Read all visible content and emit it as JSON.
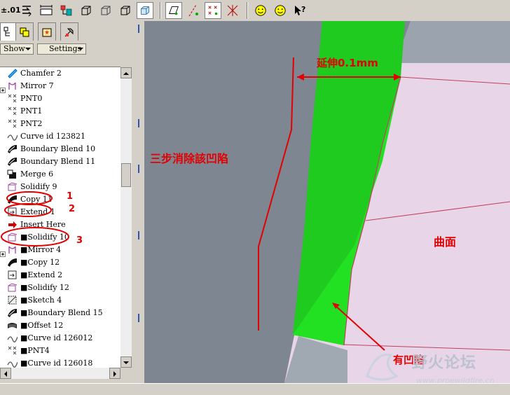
{
  "toolbar": {
    "precision_label": "±.01",
    "tools": [
      "regen-icon",
      "dimension-icon",
      "model-tree-icon",
      "view-box-1-icon",
      "view-box-2-icon",
      "view-box-3-icon",
      "shaded-view-icon",
      "datum-plane-icon",
      "datum-axis-icon",
      "datum-point-icon",
      "datum-csys-icon",
      "smiley-icon",
      "smiley-2-icon",
      "help-icon"
    ]
  },
  "panel": {
    "tabs": [
      "model-tree-tab",
      "layers-tab",
      "favorites-tab",
      "tools-tab"
    ],
    "show_label": "Show",
    "settings_label": "Settings",
    "tree_items": [
      {
        "label": "Chamfer 2",
        "icon": "chamfer-icon"
      },
      {
        "label": "Mirror 7",
        "icon": "mirror-icon"
      },
      {
        "label": "PNT0",
        "icon": "datum-point-icon"
      },
      {
        "label": "PNT1",
        "icon": "datum-point-icon"
      },
      {
        "label": "PNT2",
        "icon": "datum-point-icon"
      },
      {
        "label": "Curve id 123821",
        "icon": "curve-icon"
      },
      {
        "label": "Boundary Blend 10",
        "icon": "boundary-blend-icon"
      },
      {
        "label": "Boundary Blend 11",
        "icon": "boundary-blend-icon"
      },
      {
        "label": "Merge 6",
        "icon": "merge-icon"
      },
      {
        "label": "Solidify 9",
        "icon": "solidify-icon"
      },
      {
        "label": "Copy 11",
        "icon": "copy-icon"
      },
      {
        "label": "Extend 1",
        "icon": "extend-icon"
      },
      {
        "label": "Insert Here",
        "icon": "insert-here-icon"
      },
      {
        "label": "■Solidify 10",
        "icon": "solidify-icon"
      },
      {
        "label": "■Mirror 4",
        "icon": "mirror-icon"
      },
      {
        "label": "■Copy 12",
        "icon": "copy-icon"
      },
      {
        "label": "■Extend 2",
        "icon": "extend-icon"
      },
      {
        "label": "■Solidify 12",
        "icon": "solidify-icon"
      },
      {
        "label": "■Sketch 4",
        "icon": "sketch-icon"
      },
      {
        "label": "■Boundary Blend 15",
        "icon": "boundary-blend-icon"
      },
      {
        "label": "■Offset 12",
        "icon": "offset-icon"
      },
      {
        "label": "■Curve id 126012",
        "icon": "curve-icon"
      },
      {
        "label": "■PNT4",
        "icon": "datum-point-icon"
      },
      {
        "label": "■Curve id 126018",
        "icon": "curve-icon"
      }
    ]
  },
  "annotations": {
    "extend_label": "延伸0.1mm",
    "steps_label": "三步消除該凹陷",
    "surface_label": "曲面",
    "dent_label": "有凹陷",
    "step_numbers": [
      "1",
      "2",
      "3"
    ]
  },
  "watermark": {
    "title": "野火论坛",
    "url": "www.proewildfire.cn"
  },
  "colors": {
    "green_body": "#1ecb1e",
    "surface_pink": "#e8d4e6",
    "annotation_red": "#e30000",
    "viewport_gray": "#7d8591"
  }
}
